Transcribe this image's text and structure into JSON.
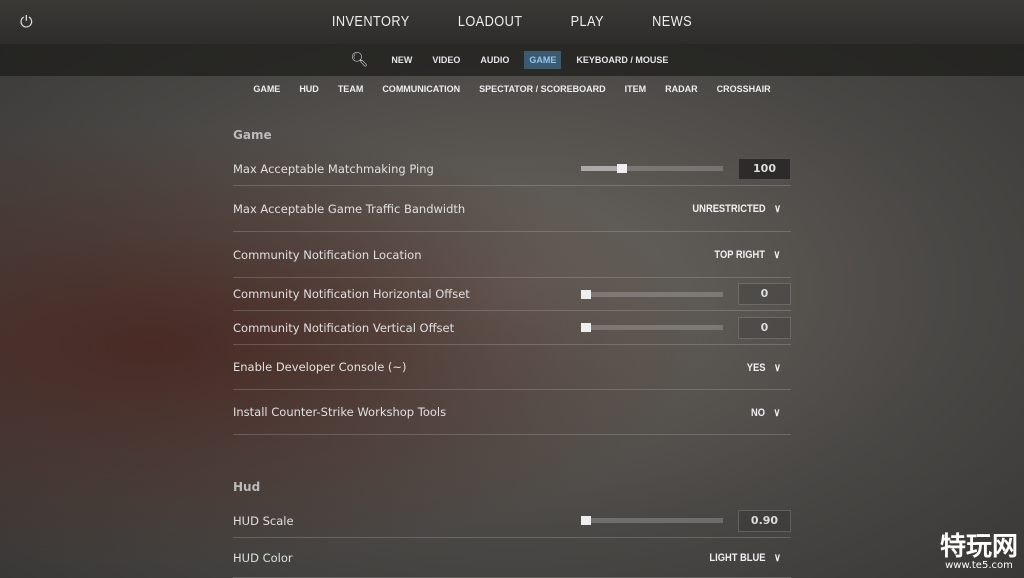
{
  "topnav": {
    "items": [
      "INVENTORY",
      "LOADOUT",
      "PLAY",
      "NEWS"
    ]
  },
  "settings_tabs": [
    {
      "label": "NEW"
    },
    {
      "label": "VIDEO"
    },
    {
      "label": "AUDIO"
    },
    {
      "label": "GAME",
      "active": true
    },
    {
      "label": "KEYBOARD / MOUSE"
    }
  ],
  "categories": [
    "GAME",
    "HUD",
    "TEAM",
    "COMMUNICATION",
    "SPECTATOR / SCOREBOARD",
    "ITEM",
    "RADAR",
    "CROSSHAIR"
  ],
  "accent": "#3c5a70",
  "sections": {
    "game": {
      "title": "Game",
      "rows": [
        {
          "label": "Max Acceptable Matchmaking Ping",
          "type": "slider",
          "value": "100",
          "fraction": 0.25
        },
        {
          "label": "Max Acceptable Game Traffic Bandwidth",
          "type": "dropdown",
          "value": "UNRESTRICTED"
        },
        {
          "label": "Community Notification Location",
          "type": "dropdown",
          "value": "TOP RIGHT"
        },
        {
          "label": "Community Notification Horizontal Offset",
          "type": "slider",
          "value": "0",
          "fraction": 0
        },
        {
          "label": "Community Notification Vertical Offset",
          "type": "slider",
          "value": "0",
          "fraction": 0
        },
        {
          "label": "Enable Developer Console (~)",
          "type": "dropdown",
          "value": "YES"
        },
        {
          "label": "Install Counter-Strike Workshop Tools",
          "type": "dropdown",
          "value": "NO"
        }
      ]
    },
    "hud": {
      "title": "Hud",
      "rows": [
        {
          "label": "HUD Scale",
          "type": "slider",
          "value": "0.90",
          "fraction": 0
        },
        {
          "label": "HUD Color",
          "type": "dropdown",
          "value": "LIGHT BLUE"
        }
      ]
    }
  },
  "watermark": {
    "text": "特玩网",
    "url": "www.te5.com"
  }
}
